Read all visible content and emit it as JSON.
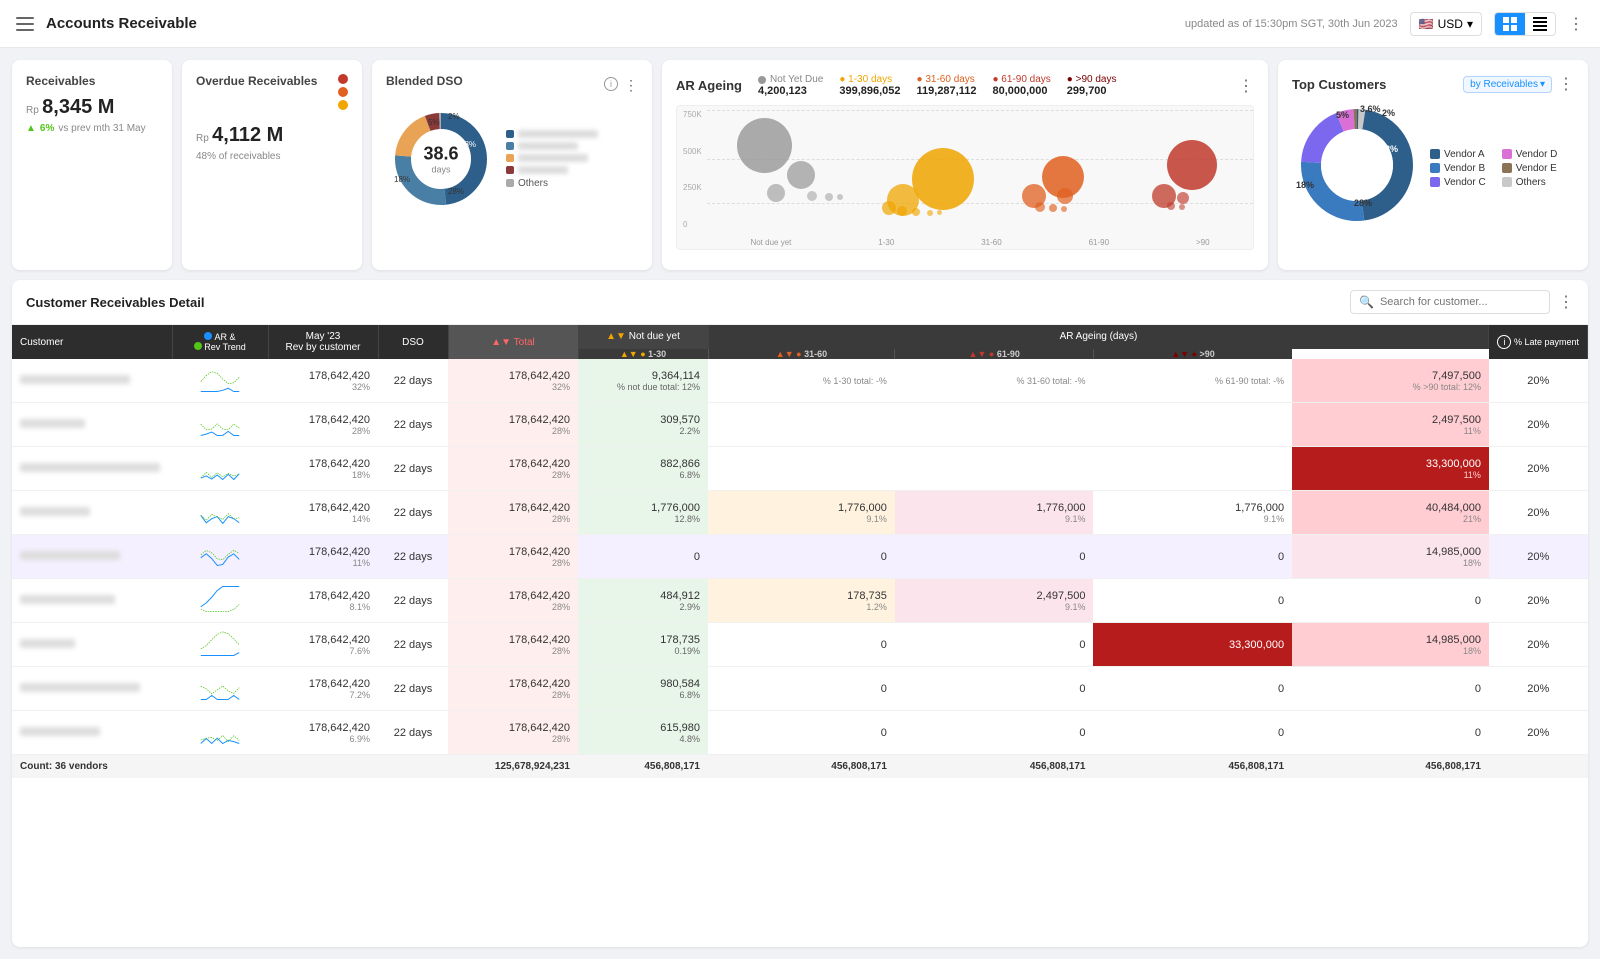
{
  "header": {
    "title": "Accounts Receivable",
    "update_text": "updated as of 15:30pm SGT, 30th Jun 2023",
    "currency": "USD",
    "flag": "🇺🇸"
  },
  "receivables": {
    "title": "Receivables",
    "currency_label": "Rp",
    "value": "8,345 M",
    "change": "6%",
    "change_label": "vs prev mth 31 May"
  },
  "overdue": {
    "title": "Overdue Receivables",
    "currency_label": "Rp",
    "value": "4,112 M",
    "sub_label": "48% of receivables"
  },
  "blended_dso": {
    "title": "Blended DSO",
    "value": "38.6",
    "unit": "days",
    "segments": [
      {
        "label": "",
        "pct": 48,
        "color": "#2d5f8a"
      },
      {
        "label": "",
        "pct": 28,
        "color": "#4a7fa5"
      },
      {
        "label": "",
        "pct": 18,
        "color": "#e8a355"
      },
      {
        "label": "",
        "pct": 5,
        "color": "#8b3a3a"
      },
      {
        "label": "Others",
        "pct": 2,
        "color": "#888"
      }
    ],
    "pct_labels": [
      "48%",
      "28%",
      "18%",
      "5%",
      "2%"
    ]
  },
  "ar_aging": {
    "title": "AR Ageing",
    "legend": [
      {
        "label": "Not Yet Due",
        "value": "4,200,123",
        "color": "#999"
      },
      {
        "label": "1-30 days",
        "value": "399,896,052",
        "color": "#f0a500"
      },
      {
        "label": "31-60 days",
        "value": "119,287,112",
        "color": "#e06020"
      },
      {
        "label": "61-90 days",
        "value": "80,000,000",
        "color": "#c0392b"
      },
      {
        "label": ">90 days",
        "value": "299,700",
        "color": "#7b0000"
      }
    ],
    "x_labels": [
      "Not due yet",
      "1-30",
      "31-60",
      "61-90",
      ">90"
    ],
    "y_labels": [
      "750K",
      "500K",
      "250K",
      "0"
    ]
  },
  "top_customers": {
    "title": "Top Customers",
    "by_label": "by Receivables",
    "segments": [
      {
        "label": "Vendor A",
        "pct": 48,
        "color": "#2d5f8a"
      },
      {
        "label": "Vendor B",
        "pct": 28,
        "color": "#3a7abf"
      },
      {
        "label": "Vendor C",
        "pct": 18,
        "color": "#7b68ee"
      },
      {
        "label": "Vendor D",
        "pct": 5,
        "color": "#da70d6"
      },
      {
        "label": "Vendor E",
        "pct": 3.6,
        "color": "#8b7355"
      },
      {
        "label": "Others",
        "pct": 2,
        "color": "#c8c8c8"
      }
    ],
    "pct_labels": [
      "48%",
      "28%",
      "18%",
      "5%",
      "3.6%",
      "2%"
    ]
  },
  "table": {
    "title": "Customer Receivables Detail",
    "search_placeholder": "Search for customer...",
    "columns": {
      "customer": "Customer",
      "trend": "AR & Rev Trend",
      "rev": "May '23 Rev by customer",
      "dso": "DSO",
      "total": "Total",
      "not_due": "Not due yet",
      "ar_1_30": "1-30",
      "ar_31_60": "31-60",
      "ar_61_90": "61-90",
      "ar_90plus": ">90",
      "late_pmt": "% Late payment",
      "ar_ageing_header": "AR Ageing (days)"
    },
    "rows": [
      {
        "highlighted": false,
        "rev": "178,642,420",
        "rev_pct": "32%",
        "dso": "22 days",
        "total": "178,642,420",
        "total_pct": "32%",
        "not_due": "9,364,114",
        "not_due_pct": "% not due total: 12%",
        "ar_1_30": "",
        "ar_1_30_pct": "% 1-30 total: -%",
        "ar_31_60": "",
        "ar_31_60_pct": "% 31-60 total: -%",
        "ar_61_90": "",
        "ar_61_90_pct": "% 61-90 total: -%",
        "ar_90plus": "7,497,500",
        "ar_90plus_pct": "% >90 total: 12%",
        "late_pmt": "20%",
        "not_due_bg": true,
        "ar_90_dark": false
      },
      {
        "highlighted": false,
        "rev": "178,642,420",
        "rev_pct": "28%",
        "dso": "22 days",
        "total": "178,642,420",
        "total_pct": "28%",
        "not_due": "309,570",
        "not_due_pct": "2.2%",
        "ar_1_30": "",
        "ar_1_30_pct": "",
        "ar_31_60": "",
        "ar_31_60_pct": "",
        "ar_61_90": "",
        "ar_61_90_pct": "",
        "ar_90plus": "2,497,500",
        "ar_90plus_pct": "11%",
        "late_pmt": "20%",
        "not_due_bg": true,
        "ar_90_dark": false
      },
      {
        "highlighted": false,
        "rev": "178,642,420",
        "rev_pct": "18%",
        "dso": "22 days",
        "total": "178,642,420",
        "total_pct": "28%",
        "not_due": "882,866",
        "not_due_pct": "6.8%",
        "ar_1_30": "",
        "ar_1_30_pct": "",
        "ar_31_60": "",
        "ar_31_60_pct": "",
        "ar_61_90": "",
        "ar_61_90_pct": "",
        "ar_90plus": "33,300,000",
        "ar_90plus_pct": "11%",
        "late_pmt": "20%",
        "not_due_bg": true,
        "ar_90_dark": true
      },
      {
        "highlighted": false,
        "rev": "178,642,420",
        "rev_pct": "14%",
        "dso": "22 days",
        "total": "178,642,420",
        "total_pct": "28%",
        "not_due": "1,776,000",
        "not_due_pct": "12.8%",
        "ar_1_30": "1,776,000",
        "ar_1_30_pct": "9.1%",
        "ar_31_60": "1,776,000",
        "ar_31_60_pct": "9.1%",
        "ar_61_90": "1,776,000",
        "ar_61_90_pct": "9.1%",
        "ar_90plus": "40,484,000",
        "ar_90plus_pct": "21%",
        "late_pmt": "20%",
        "not_due_bg": true,
        "ar_90_dark": false
      },
      {
        "highlighted": true,
        "rev": "178,642,420",
        "rev_pct": "11%",
        "dso": "22 days",
        "total": "178,642,420",
        "total_pct": "28%",
        "not_due": "0",
        "not_due_pct": "",
        "ar_1_30": "0",
        "ar_1_30_pct": "",
        "ar_31_60": "0",
        "ar_31_60_pct": "",
        "ar_61_90": "0",
        "ar_61_90_pct": "",
        "ar_90plus": "14,985,000",
        "ar_90plus_pct": "18%",
        "late_pmt": "20%",
        "not_due_bg": false,
        "ar_90_dark": false,
        "ar_90_pink": true
      },
      {
        "highlighted": false,
        "rev": "178,642,420",
        "rev_pct": "8.1%",
        "dso": "22 days",
        "total": "178,642,420",
        "total_pct": "28%",
        "not_due": "484,912",
        "not_due_pct": "2.9%",
        "ar_1_30": "178,735",
        "ar_1_30_pct": "1.2%",
        "ar_31_60": "2,497,500",
        "ar_31_60_pct": "9.1%",
        "ar_61_90": "0",
        "ar_61_90_pct": "",
        "ar_90plus": "0",
        "ar_90plus_pct": "",
        "late_pmt": "20%",
        "not_due_bg": true,
        "ar_90_dark": false
      },
      {
        "highlighted": false,
        "rev": "178,642,420",
        "rev_pct": "7.6%",
        "dso": "22 days",
        "total": "178,642,420",
        "total_pct": "28%",
        "not_due": "178,735",
        "not_due_pct": "0.19%",
        "ar_1_30": "0",
        "ar_1_30_pct": "",
        "ar_31_60": "0",
        "ar_31_60_pct": "",
        "ar_61_90": "33,300,000",
        "ar_61_90_pct": "",
        "ar_90plus": "14,985,000",
        "ar_90plus_pct": "18%",
        "late_pmt": "20%",
        "not_due_bg": true,
        "ar_90_dark": false,
        "ar_61_dark": true
      },
      {
        "highlighted": false,
        "rev": "178,642,420",
        "rev_pct": "7.2%",
        "dso": "22 days",
        "total": "178,642,420",
        "total_pct": "28%",
        "not_due": "980,584",
        "not_due_pct": "6.8%",
        "ar_1_30": "0",
        "ar_1_30_pct": "",
        "ar_31_60": "0",
        "ar_31_60_pct": "",
        "ar_61_90": "0",
        "ar_61_90_pct": "",
        "ar_90plus": "0",
        "ar_90plus_pct": "",
        "late_pmt": "20%",
        "not_due_bg": true,
        "ar_90_dark": false
      },
      {
        "highlighted": false,
        "rev": "178,642,420",
        "rev_pct": "6.9%",
        "dso": "22 days",
        "total": "178,642,420",
        "total_pct": "28%",
        "not_due": "615,980",
        "not_due_pct": "4.8%",
        "ar_1_30": "0",
        "ar_1_30_pct": "",
        "ar_31_60": "0",
        "ar_31_60_pct": "",
        "ar_61_90": "0",
        "ar_61_90_pct": "",
        "ar_90plus": "0",
        "ar_90plus_pct": "",
        "late_pmt": "20%",
        "not_due_bg": true,
        "ar_90_dark": false
      }
    ],
    "footer": {
      "count_label": "Count: 36 vendors",
      "total": "125,678,924,231",
      "not_due_total": "456,808,171",
      "ar_1_30_total": "456,808,171",
      "ar_31_60_total": "456,808,171",
      "ar_61_90_total": "456,808,171",
      "ar_90plus_total": "456,808,171"
    }
  }
}
